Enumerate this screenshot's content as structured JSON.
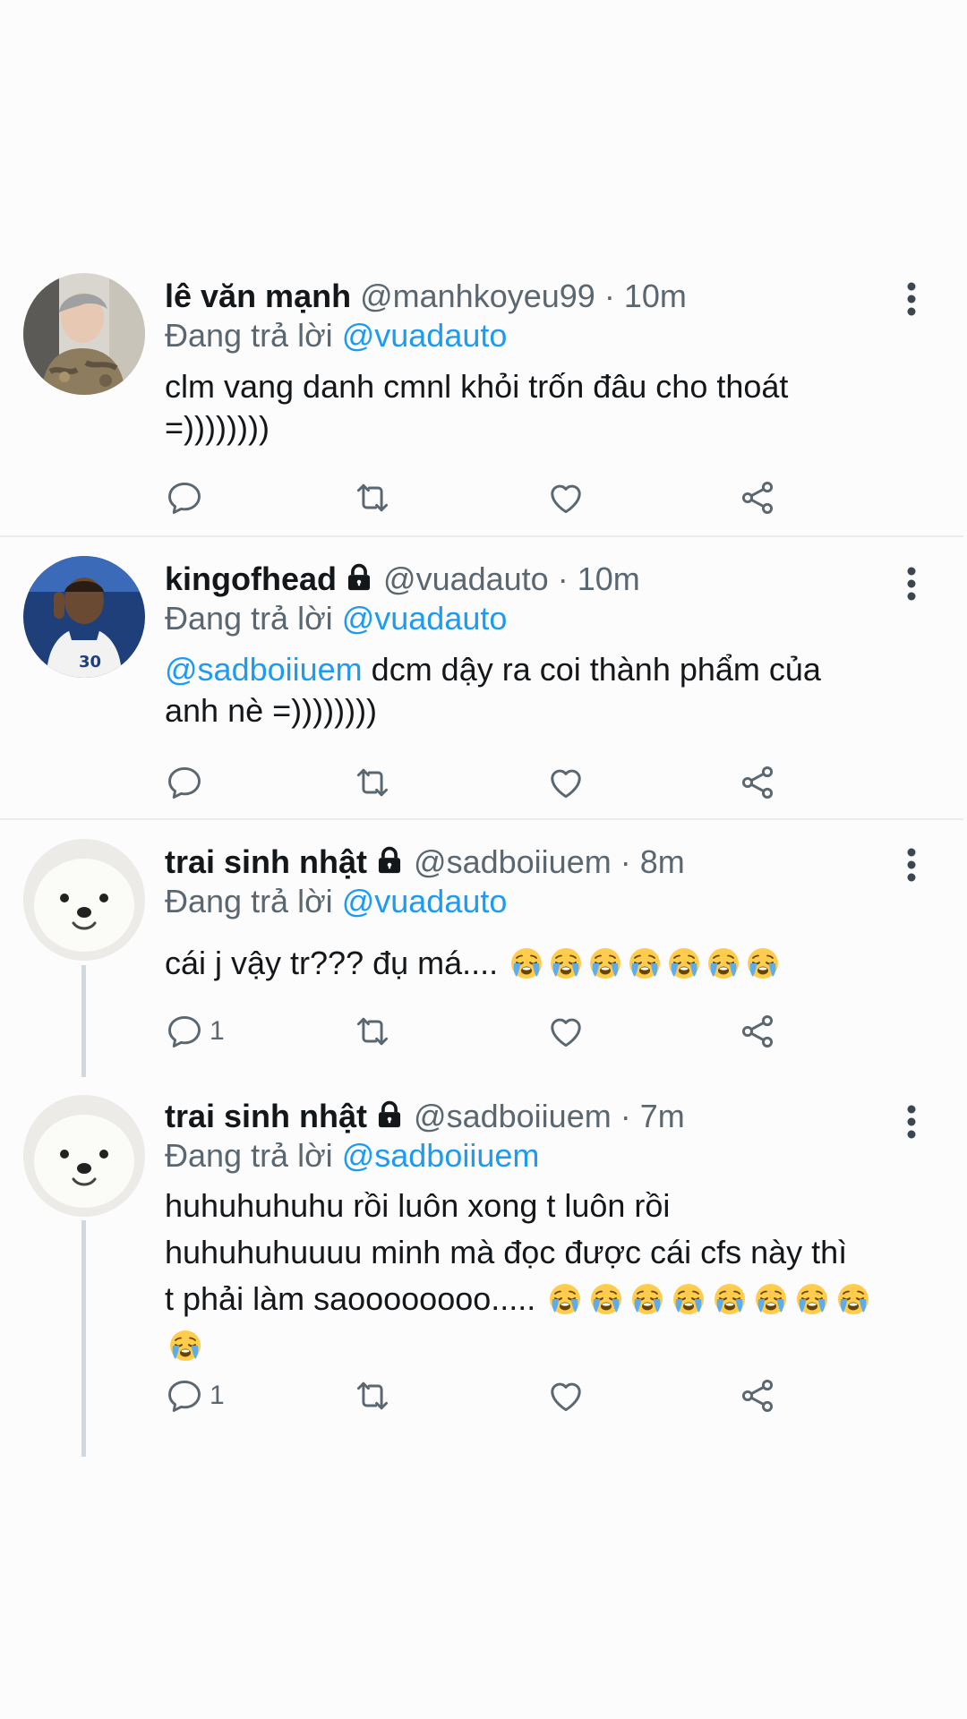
{
  "colors": {
    "accent": "#1d9bf0",
    "secondary_text": "#5b6770",
    "primary_text": "#14171a",
    "divider": "#e6ecf0"
  },
  "tweets": [
    {
      "name": "lê văn mạnh",
      "handle": "@manhkoyeu99",
      "dot": "·",
      "time": "10m",
      "replying_prefix": "Đang trả lời",
      "replying_to": "@vuadauto",
      "text_lines": [
        "clm vang danh cmnl khỏi trốn đâu cho thoát",
        "=))))))))"
      ],
      "reply_count": ""
    },
    {
      "name": "kingofhead",
      "handle": "@vuadauto",
      "dot": "·",
      "time": "10m",
      "replying_prefix": "Đang trả lời",
      "replying_to": "@vuadauto",
      "text_mention": "@sadboiiuem",
      "text_rest": " dcm dậy ra coi thành phẩm của",
      "text_line2": "anh nè =))))))))",
      "reply_count": ""
    },
    {
      "name": "trai sinh nhật",
      "handle": "@sadboiiuem",
      "dot": "·",
      "time": "8m",
      "replying_prefix": "Đang trả lời",
      "replying_to": "@vuadauto",
      "text": "cái j vậy tr??? đụ má....",
      "emoji": "loudly-crying-face",
      "emoji_count": 7,
      "reply_count": "1"
    },
    {
      "name": "trai sinh nhật",
      "handle": "@sadboiiuem",
      "dot": "·",
      "time": "7m",
      "replying_prefix": "Đang trả lời",
      "replying_to": "@sadboiiuem",
      "text_lines": [
        "huhuhuhuhu rồi luôn xong t luôn rồi",
        "huhuhuhuuuu minh mà đọc được cái cfs này thì",
        "t phải làm saoooooooo....."
      ],
      "emoji": "loudly-crying-face",
      "emoji_count": 9,
      "reply_count": "1"
    }
  ]
}
